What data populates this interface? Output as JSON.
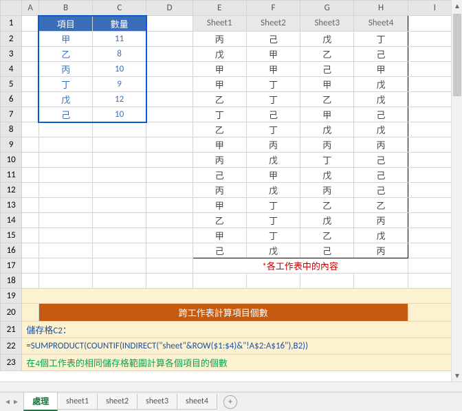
{
  "colHeaders": [
    "A",
    "B",
    "C",
    "D",
    "E",
    "F",
    "G",
    "H",
    "I"
  ],
  "rowHeaders": [
    1,
    2,
    3,
    4,
    5,
    6,
    7,
    8,
    9,
    10,
    11,
    12,
    13,
    14,
    15,
    16,
    17,
    18,
    19,
    20,
    21,
    22,
    23
  ],
  "blueTable": {
    "header": {
      "item": "項目",
      "qty": "數量"
    },
    "rows": [
      {
        "item": "甲",
        "qty": "11"
      },
      {
        "item": "乙",
        "qty": "8"
      },
      {
        "item": "丙",
        "qty": "10"
      },
      {
        "item": "丁",
        "qty": "9"
      },
      {
        "item": "戊",
        "qty": "12"
      },
      {
        "item": "己",
        "qty": "10"
      }
    ]
  },
  "sheetTable": {
    "header": [
      "Sheet1",
      "Sheet2",
      "Sheet3",
      "Sheet4"
    ],
    "rows": [
      [
        "丙",
        "己",
        "戊",
        "丁"
      ],
      [
        "戊",
        "甲",
        "乙",
        "己"
      ],
      [
        "甲",
        "甲",
        "己",
        "甲"
      ],
      [
        "甲",
        "丁",
        "甲",
        "戊"
      ],
      [
        "乙",
        "丁",
        "乙",
        "戊"
      ],
      [
        "丁",
        "己",
        "甲",
        "己"
      ],
      [
        "乙",
        "丁",
        "戊",
        "戊"
      ],
      [
        "甲",
        "丙",
        "丙",
        "丙"
      ],
      [
        "丙",
        "戊",
        "丁",
        "己"
      ],
      [
        "己",
        "甲",
        "戊",
        "己"
      ],
      [
        "丙",
        "戊",
        "丙",
        "己"
      ],
      [
        "甲",
        "丁",
        "乙",
        "乙"
      ],
      [
        "乙",
        "丁",
        "戊",
        "丙"
      ],
      [
        "甲",
        "丁",
        "乙",
        "戊"
      ],
      [
        "己",
        "戊",
        "己",
        "丙"
      ]
    ]
  },
  "caption": "*各工作表中的內容",
  "infoBox": {
    "title": "跨工作表計算項目個數",
    "cellLabel": "儲存格C2：",
    "formula": "=SUMPRODUCT(COUNTIF(INDIRECT(\"sheet\"&ROW($1:$4)&\"!A$2:A$16\"),B2))",
    "description": "在4個工作表的相同儲存格範圍計算各個項目的個數"
  },
  "tabs": {
    "active": "處理",
    "others": [
      "sheet1",
      "sheet2",
      "sheet3",
      "sheet4"
    ]
  }
}
